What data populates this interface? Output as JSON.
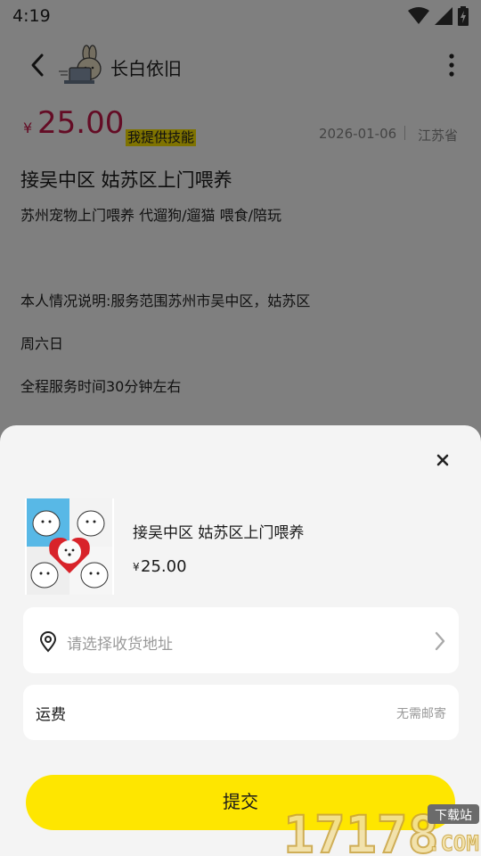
{
  "status_bar": {
    "time": "4:19",
    "icons": [
      "wifi-icon",
      "signal-icon",
      "battery-icon"
    ]
  },
  "header": {
    "seller_name": "长白依旧",
    "back_icon": "chevron-left-icon",
    "more_icon": "more-vertical-icon"
  },
  "listing": {
    "currency": "¥",
    "price": "25.00",
    "tag": "我提供技能",
    "date": "2026-01-06",
    "location": "江苏省",
    "title": "接吴中区 姑苏区上门喂养",
    "subtitle": "苏州宠物上门喂养 代遛狗/遛猫 喂食/陪玩",
    "paragraphs": [
      "本人情况说明:服务范围苏州市吴中区，姑苏区",
      "周六日",
      "全程服务时间30分钟左右"
    ]
  },
  "sheet": {
    "close_icon": "close-icon",
    "product": {
      "title": "接吴中区 姑苏区上门喂养",
      "currency": "¥",
      "price": "25.00"
    },
    "address": {
      "placeholder": "请选择收货地址"
    },
    "shipping": {
      "label": "运费",
      "value": "无需邮寄"
    },
    "submit_label": "提交"
  },
  "watermark": {
    "number": "17178",
    "tag": "下载站",
    "suffix": ".COM"
  },
  "colors": {
    "accent_yellow": "#fee600",
    "price_red": "#c8184a",
    "overlay": "rgba(0,0,0,0.5)"
  }
}
